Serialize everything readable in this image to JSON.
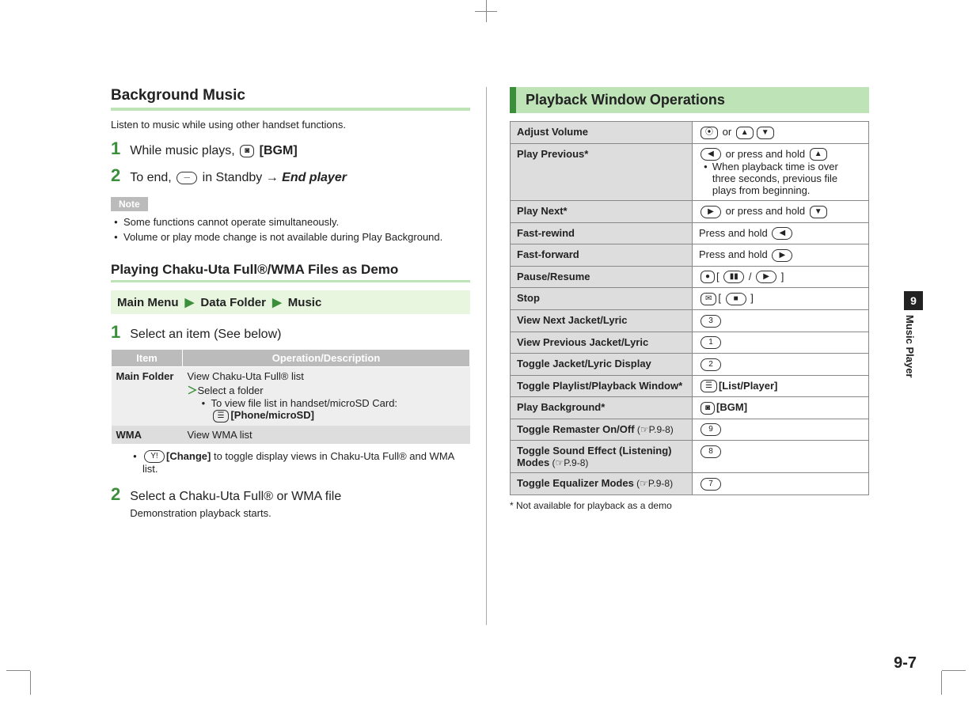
{
  "left": {
    "h_bg": "Background Music",
    "bg_intro": "Listen to music while using other handset functions.",
    "step1_a": "While music plays, ",
    "step1_key": "📷",
    "step1_b": "[BGM]",
    "step2_a": "To end, ",
    "step2_key": "⏤",
    "step2_b": " in Standby → ",
    "step2_c": "End player",
    "note_label": "Note",
    "note1": "Some functions cannot operate simultaneously.",
    "note2": "Volume or play mode change is not available during Play Background.",
    "h_chaku": "Playing Chaku-Uta Full®/WMA Files as Demo",
    "menu1": "Main Menu",
    "menu2": "Data Folder",
    "menu3": "Music",
    "chaku_step1": "Select an item (See below)",
    "th_item": "Item",
    "th_op": "Operation/Description",
    "row1_label": "Main Folder",
    "row1_line1": "View Chaku-Uta Full® list",
    "row1_line2": "Select a folder",
    "row1_line3": "To view file list in handset/microSD Card:",
    "row1_line3b": "[Phone/microSD]",
    "row2_label": "WMA",
    "row2_line1": "View WMA list",
    "tip_change": "[Change]",
    "tip_text": " to toggle display views in Chaku-Uta Full® and WMA list.",
    "chaku_step2a": "Select a Chaku-Uta Full® or WMA file",
    "chaku_step2b": "Demonstration playback starts."
  },
  "right": {
    "h_ops": "Playback Window Operations",
    "rows": [
      {
        "label": "Adjust Volume",
        "ref": "",
        "action_html": "vol"
      },
      {
        "label": "Play Previous*",
        "ref": "",
        "action_html": "prev"
      },
      {
        "label": "Play Next*",
        "ref": "",
        "action_html": "next"
      },
      {
        "label": "Fast-rewind",
        "ref": "",
        "action_html": "frw"
      },
      {
        "label": "Fast-forward",
        "ref": "",
        "action_html": "ffw"
      },
      {
        "label": "Pause/Resume",
        "ref": "",
        "action_html": "pause"
      },
      {
        "label": "Stop",
        "ref": "",
        "action_html": "stop"
      },
      {
        "label": "View Next Jacket/Lyric",
        "ref": "",
        "action_html": "k3"
      },
      {
        "label": "View Previous Jacket/Lyric",
        "ref": "",
        "action_html": "k1"
      },
      {
        "label": "Toggle Jacket/Lyric Display",
        "ref": "",
        "action_html": "k2"
      },
      {
        "label": "Toggle Playlist/Playback Window*",
        "ref": "",
        "action_html": "listplayer"
      },
      {
        "label": "Play Background*",
        "ref": "",
        "action_html": "bgm"
      },
      {
        "label": "Toggle Remaster On/Off",
        "ref": " (☞P.9-8)",
        "action_html": "k9"
      },
      {
        "label": "Toggle Sound Effect (Listening) Modes",
        "ref": " (☞P.9-8)",
        "action_html": "k8"
      },
      {
        "label": "Toggle Equalizer Modes",
        "ref": " (☞P.9-8)",
        "action_html": "k7"
      }
    ],
    "actions": {
      "vol_or": " or ",
      "prev_a": " or press and hold ",
      "prev_note": "When playback time is over three seconds, previous file plays from beginning.",
      "next_a": " or press and hold ",
      "frw": "Press and hold ",
      "ffw": "Press and hold ",
      "listplayer": "[List/Player]",
      "bgm": "[BGM]"
    },
    "footnote": "* Not available for playback as a demo"
  },
  "side": {
    "num": "9",
    "label": "Music Player"
  },
  "pagenum": "9-7"
}
